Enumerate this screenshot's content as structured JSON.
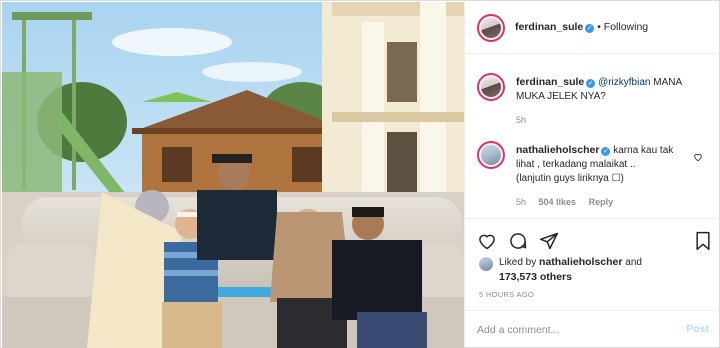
{
  "header": {
    "username": "ferdinan_sule",
    "separator": "•",
    "follow_status": "Following"
  },
  "caption": {
    "username": "ferdinan_sule",
    "mention": "@rizkyfbian",
    "text": "MANA MUKA JELEK NYA?",
    "time": "5h"
  },
  "comment": {
    "username": "nathalieholscher",
    "text_line1": "karna kau tak",
    "text_line2": "lihat , terkadang malaikat ..",
    "text_line3": "(lanjutin guys liriknya ☐)",
    "time": "5h",
    "likes": "504 likes",
    "reply": "Reply"
  },
  "likes": {
    "prefix": "Liked by",
    "user": "nathalieholscher",
    "conj": "and",
    "count": "173,573 others"
  },
  "posted_ago": "5 HOURS AGO",
  "add_comment": {
    "placeholder": "Add a comment...",
    "post_label": "Post"
  },
  "icons": {
    "verified": "verified-badge-icon",
    "heart": "heart-icon",
    "comment": "comment-icon",
    "share": "share-icon",
    "save": "bookmark-icon"
  },
  "colors": {
    "verified": "#3897f0",
    "mention": "#00376b",
    "muted": "#8e8e8e",
    "post_disabled": "#b2dffc"
  }
}
